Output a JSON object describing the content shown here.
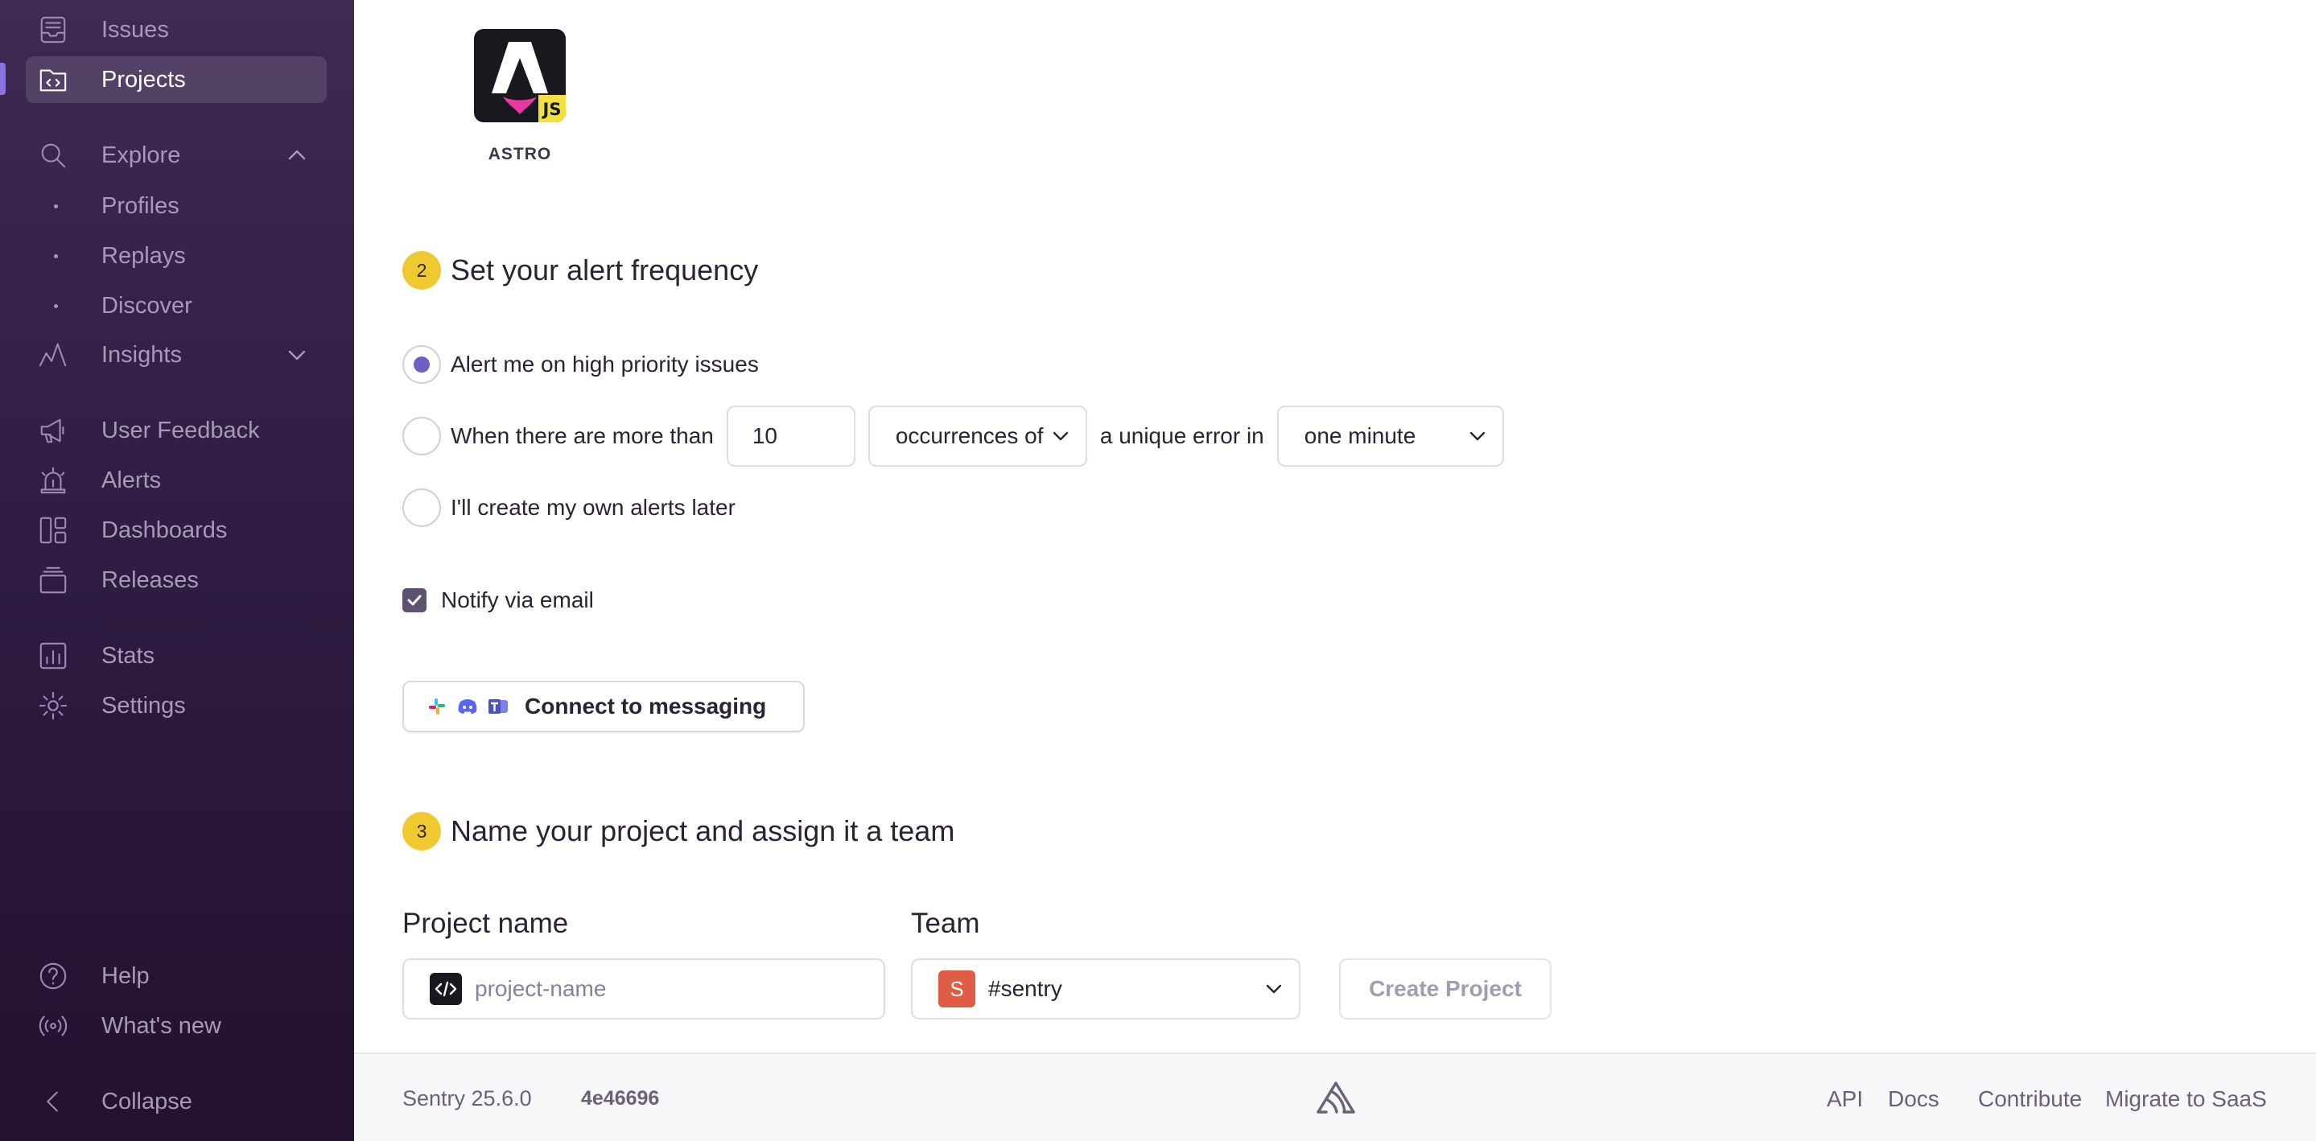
{
  "sidebar": {
    "items": [
      {
        "label": "Issues"
      },
      {
        "label": "Projects"
      },
      {
        "label": "Explore"
      },
      {
        "label": "Profiles"
      },
      {
        "label": "Replays"
      },
      {
        "label": "Discover"
      },
      {
        "label": "Insights"
      },
      {
        "label": "User Feedback"
      },
      {
        "label": "Alerts"
      },
      {
        "label": "Dashboards"
      },
      {
        "label": "Releases"
      },
      {
        "label": "Stats"
      },
      {
        "label": "Settings"
      },
      {
        "label": "Help"
      },
      {
        "label": "What's new"
      },
      {
        "label": "Collapse"
      }
    ],
    "active": "Projects"
  },
  "platform": {
    "name": "ASTRO",
    "badge": "JS"
  },
  "step2": {
    "number": "2",
    "title": "Set your alert frequency",
    "options": {
      "high_priority": "Alert me on high priority issues",
      "when_more_than": "When there are more than",
      "count_value": "10",
      "occurrences_select": "occurrences of",
      "unique_error_in": "a unique error in",
      "interval_select": "one minute",
      "later": "I'll create my own alerts later"
    },
    "selected": "high_priority",
    "notify_email": "Notify via email",
    "notify_checked": true,
    "connect_button": "Connect to messaging"
  },
  "step3": {
    "number": "3",
    "title": "Name your project and assign it a team",
    "project_name_label": "Project name",
    "project_name_placeholder": "project-name",
    "team_label": "Team",
    "team_avatar": "S",
    "team_value": "#sentry",
    "create_button": "Create Project"
  },
  "footer": {
    "version": "Sentry 25.6.0",
    "commit": "4e46696",
    "links": [
      "API",
      "Docs",
      "Contribute",
      "Migrate to SaaS"
    ]
  },
  "colors": {
    "accent": "#6c5fc7",
    "step_badge": "#f0c830",
    "team_avatar": "#e05d45"
  }
}
